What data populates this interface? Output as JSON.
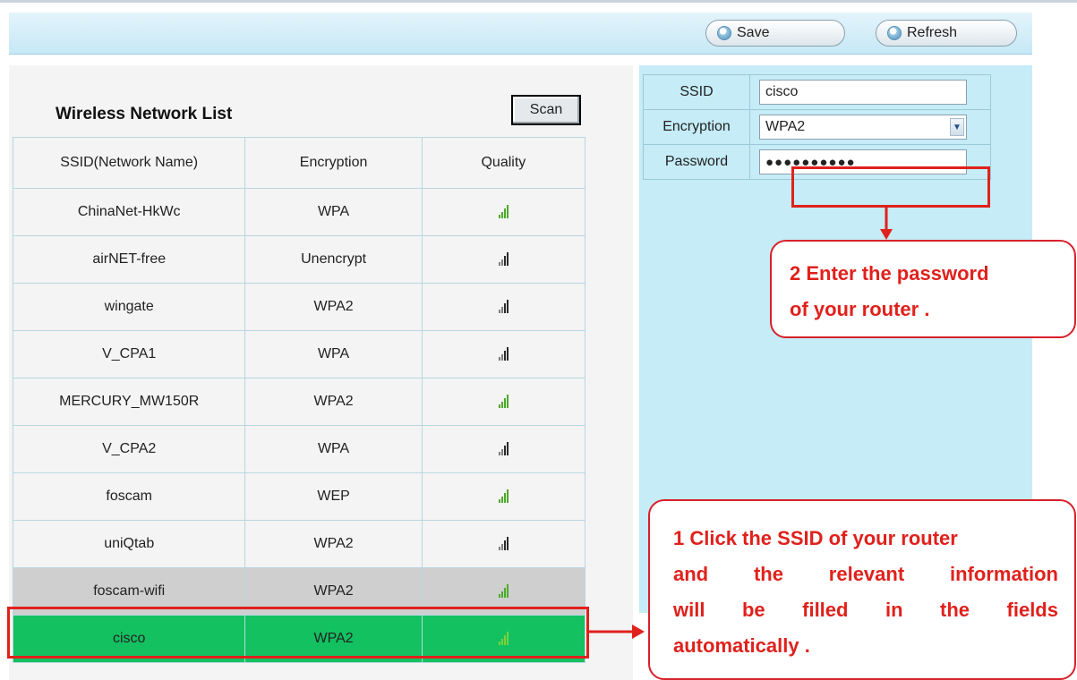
{
  "toolbar": {
    "save_label": "Save",
    "refresh_label": "Refresh"
  },
  "list": {
    "title": "Wireless Network List",
    "scan_label": "Scan",
    "columns": [
      "SSID(Network Name)",
      "Encryption",
      "Quality"
    ],
    "rows": [
      {
        "ssid": "ChinaNet-HkWc",
        "encryption": "WPA",
        "quality_icon": "signal-bars-icon"
      },
      {
        "ssid": "airNET-free",
        "encryption": "Unencrypt",
        "quality_icon": "signal-bars-icon"
      },
      {
        "ssid": "wingate",
        "encryption": "WPA2",
        "quality_icon": "signal-bars-icon"
      },
      {
        "ssid": "V_CPA1",
        "encryption": "WPA",
        "quality_icon": "signal-bars-icon"
      },
      {
        "ssid": "MERCURY_MW150R",
        "encryption": "WPA2",
        "quality_icon": "signal-bars-icon"
      },
      {
        "ssid": "V_CPA2",
        "encryption": "WPA",
        "quality_icon": "signal-bars-icon"
      },
      {
        "ssid": "foscam",
        "encryption": "WEP",
        "quality_icon": "signal-bars-icon"
      },
      {
        "ssid": "uniQtab",
        "encryption": "WPA2",
        "quality_icon": "signal-bars-icon"
      },
      {
        "ssid": "foscam-wifi",
        "encryption": "WPA2",
        "quality_icon": "signal-bars-icon"
      },
      {
        "ssid": "cisco",
        "encryption": "WPA2",
        "quality_icon": "signal-bars-icon"
      }
    ]
  },
  "form": {
    "ssid_label": "SSID",
    "ssid_value": "cisco",
    "encryption_label": "Encryption",
    "encryption_value": "WPA2",
    "password_label": "Password",
    "password_value": "●●●●●●●●●●"
  },
  "callouts": {
    "password_line1": "2 Enter the password",
    "password_line2": "of your router .",
    "ssid_line1": "1 Click the SSID of your router",
    "ssid_line2": "and the relevant information",
    "ssid_line3": "will be filled in the fields",
    "ssid_line4": "automatically ."
  },
  "colors": {
    "accent_red": "#e0211c",
    "selected_row": "#13c160",
    "panel": "#c5ecf7"
  }
}
